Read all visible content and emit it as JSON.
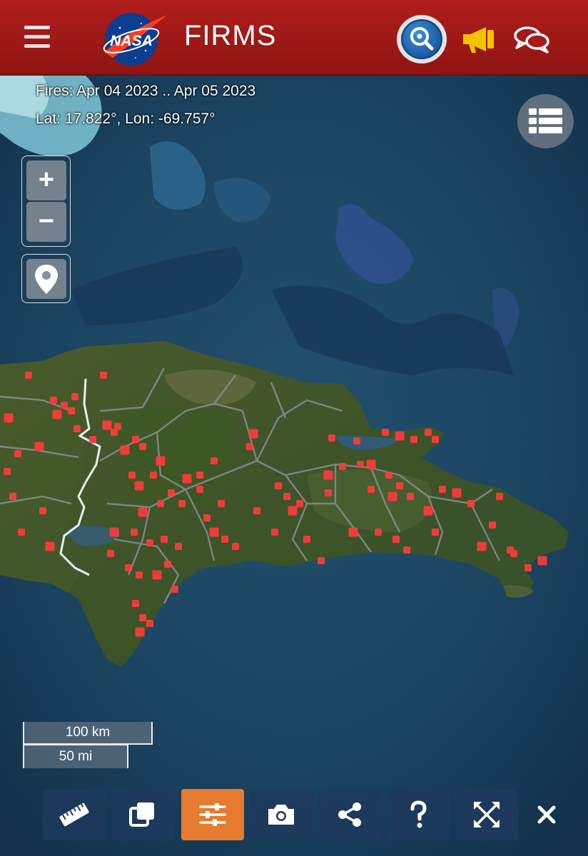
{
  "header": {
    "app_title": "FIRMS",
    "logo_text": "NASA",
    "icons": [
      "menu-icon",
      "nasa-logo",
      "search-icon",
      "megaphone-icon",
      "chat-icon"
    ],
    "colors": {
      "bar": "#a51b18",
      "megaphone": "#f2c300",
      "search_blue": "#1b5aa2"
    }
  },
  "map": {
    "fires_label": "Fires: Apr 04 2023 .. Apr 05 2023",
    "latlon_label": "Lat: 17.822°, Lon: -69.757°",
    "zoom_in_label": "+",
    "zoom_out_label": "−",
    "scale": {
      "km_label": "100 km",
      "mi_label": "50 mi"
    },
    "fire_color": "#ff3b3b",
    "icons": [
      "layers-icon",
      "location-pin-icon"
    ]
  },
  "toolbar": {
    "items": [
      {
        "name": "measure",
        "icon": "ruler-icon",
        "active": false
      },
      {
        "name": "compare",
        "icon": "layers-copy-icon",
        "active": false
      },
      {
        "name": "filters",
        "icon": "sliders-icon",
        "active": true
      },
      {
        "name": "snapshot",
        "icon": "camera-icon",
        "active": false
      },
      {
        "name": "share",
        "icon": "share-icon",
        "active": false
      },
      {
        "name": "help",
        "icon": "help-icon",
        "active": false
      },
      {
        "name": "fullscreen",
        "icon": "fullscreen-icon",
        "active": false
      },
      {
        "name": "close",
        "icon": "close-icon",
        "active": false
      }
    ],
    "active_color": "#e67a2f"
  }
}
